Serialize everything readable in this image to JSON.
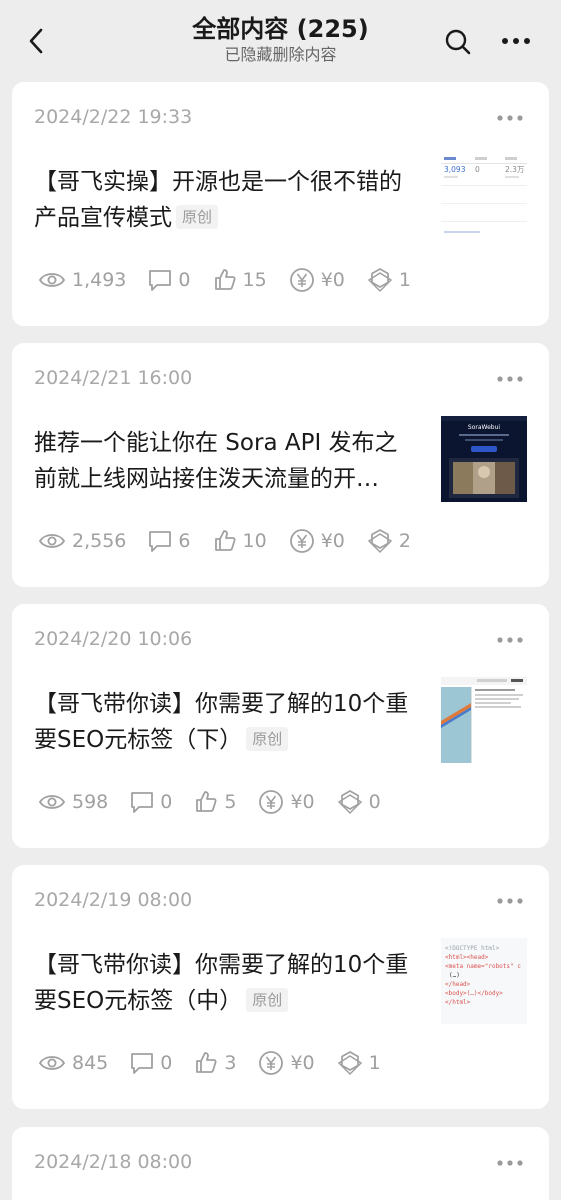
{
  "header": {
    "title": "全部内容 (225)",
    "subtitle": "已隐藏删除内容"
  },
  "articles": [
    {
      "date": "2024/2/22 19:33",
      "title": "【哥飞实操】开源也是一个很不错的产品宣传模式",
      "badge": "原创",
      "views": "1,493",
      "comments": "0",
      "likes": "15",
      "rewards": "¥0",
      "shares": "1",
      "thumb": {
        "stats": [
          "3,093",
          "0",
          "2.3万"
        ]
      }
    },
    {
      "date": "2024/2/21 16:00",
      "title": "推荐一个能让你在 Sora API 发布之前就上线网站接住泼天流量的开…",
      "badge": "",
      "views": "2,556",
      "comments": "6",
      "likes": "10",
      "rewards": "¥0",
      "shares": "2",
      "thumb": {
        "heading": "SoraWebui"
      }
    },
    {
      "date": "2024/2/20 10:06",
      "title": "【哥飞带你读】你需要了解的10个重要SEO元标签（下）",
      "badge": "原创",
      "views": "598",
      "comments": "0",
      "likes": "5",
      "rewards": "¥0",
      "shares": "0"
    },
    {
      "date": "2024/2/19 08:00",
      "title": "【哥飞带你读】你需要了解的10个重要SEO元标签（中）",
      "badge": "原创",
      "views": "845",
      "comments": "0",
      "likes": "3",
      "rewards": "¥0",
      "shares": "1",
      "thumb": {
        "code": [
          "<!DOCTYPE html>",
          "<html><head>",
          "<meta name=\"robots\" c",
          "(…)",
          "</head>",
          "<body>(…)</body>",
          "</html>"
        ]
      }
    },
    {
      "date": "2024/2/18 08:00"
    }
  ],
  "colors": {
    "background": "#ededed",
    "card": "#ffffff",
    "muted": "#a0a0a0",
    "text": "#1a1a1a"
  }
}
